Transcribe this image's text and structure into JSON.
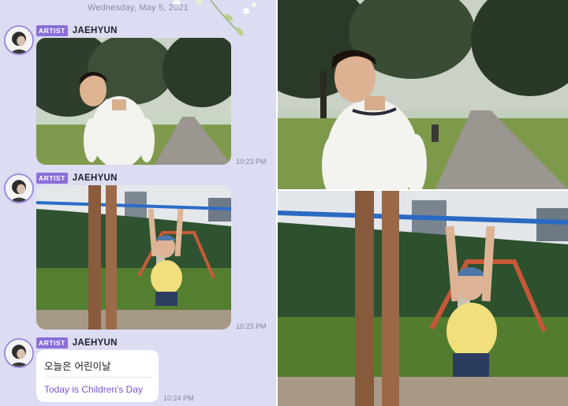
{
  "chat": {
    "date_label": "Wednesday, May 5, 2021",
    "messages": [
      {
        "badge": "ARTIST",
        "sender": "JAEHYUN",
        "type": "photo",
        "time": "10:23 PM"
      },
      {
        "badge": "ARTIST",
        "sender": "JAEHYUN",
        "type": "photo",
        "time": "10:23 PM"
      },
      {
        "badge": "ARTIST",
        "sender": "JAEHYUN",
        "type": "text",
        "text_original": "오늘은 어린이날",
        "text_translated": "Today is Children's Day",
        "time": "10:24 PM"
      }
    ]
  },
  "colors": {
    "chat_background": "#dcdcf2",
    "artist_badge": "#8a6fd8",
    "translation_text": "#7b55d6",
    "avatar_ring": "#9b8ddc"
  },
  "icons": {
    "avatar": "profile-photo"
  }
}
